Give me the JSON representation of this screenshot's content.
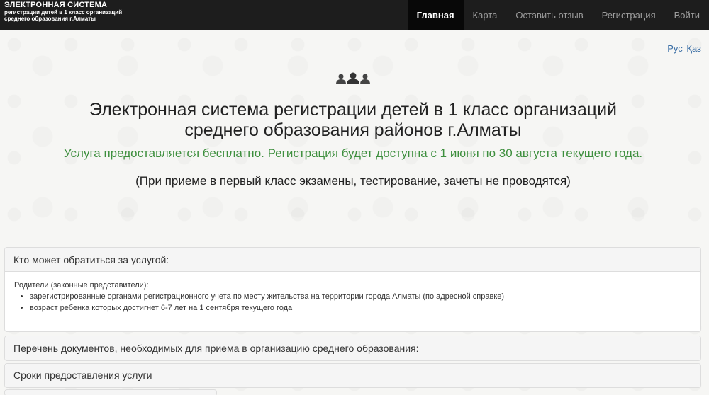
{
  "navbar": {
    "brand_title": "ЭЛЕКТРОННАЯ СИСТЕМА",
    "brand_subtitle": "регистрации детей в 1 класс организаций среднего образования г.Алматы",
    "items": [
      {
        "label": "Главная",
        "active": true
      },
      {
        "label": "Карта",
        "active": false
      },
      {
        "label": "Оставить отзыв",
        "active": false
      },
      {
        "label": "Регистрация",
        "active": false
      },
      {
        "label": "Войти",
        "active": false
      }
    ]
  },
  "language": {
    "rus": "Рус",
    "kaz": "Қаз"
  },
  "hero": {
    "icon": "users-icon",
    "title_line1": "Электронная система регистрации детей в 1 класс организаций",
    "title_line2": "среднего образования районов г.Алматы",
    "free_notice": "Услуга предоставляется бесплатно. Регистрация будет доступна с 1 июня по 30 августа текущего года.",
    "exam_note": "(При приеме в первый класс экзамены, тестирование, зачеты не проводятся)"
  },
  "panels": [
    {
      "heading": "Кто может обратиться за услугой:",
      "body_intro": "Родители (законные представители):",
      "items": [
        "зарегистрированные органами регистрационного учета по месту жительства на территории города Алматы (по адресной справке)",
        "возраст ребенка которых достигнет 6-7 лет на 1 сентября текущего года"
      ]
    },
    {
      "heading": "Перечень документов, необходимых для приема в организацию среднего образования:"
    },
    {
      "heading": "Сроки предоставления услуги"
    }
  ],
  "colors": {
    "navbar_bg": "#1d1d1d",
    "active_nav_bg": "#080808",
    "green_text": "#3e8f3e",
    "link": "#3a6ea5"
  }
}
